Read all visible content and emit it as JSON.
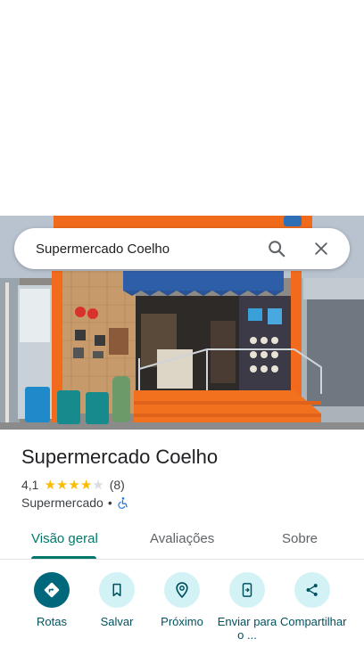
{
  "search": {
    "query": "Supermercado Coelho"
  },
  "place": {
    "name": "Supermercado Coelho",
    "rating": "4,1",
    "rating_value": 4.1,
    "reviews_count": "(8)",
    "category": "Supermercado",
    "separator": "•",
    "accessibility_icon": "wheelchair-icon"
  },
  "tabs": [
    {
      "label": "Visão geral",
      "active": true
    },
    {
      "label": "Avaliações",
      "active": false
    },
    {
      "label": "Sobre",
      "active": false
    }
  ],
  "actions": [
    {
      "label": "Rotas",
      "icon": "directions-icon"
    },
    {
      "label": "Salvar",
      "icon": "bookmark-icon"
    },
    {
      "label": "Próximo",
      "icon": "nearby-icon"
    },
    {
      "label": "Enviar para o ...",
      "icon": "send-to-phone-icon"
    },
    {
      "label": "Compartilhar",
      "icon": "share-icon"
    }
  ],
  "colors": {
    "accent": "#00796b",
    "star": "#fbbc04",
    "action_bg": "#d3f2f5",
    "action_primary": "#00687a"
  }
}
